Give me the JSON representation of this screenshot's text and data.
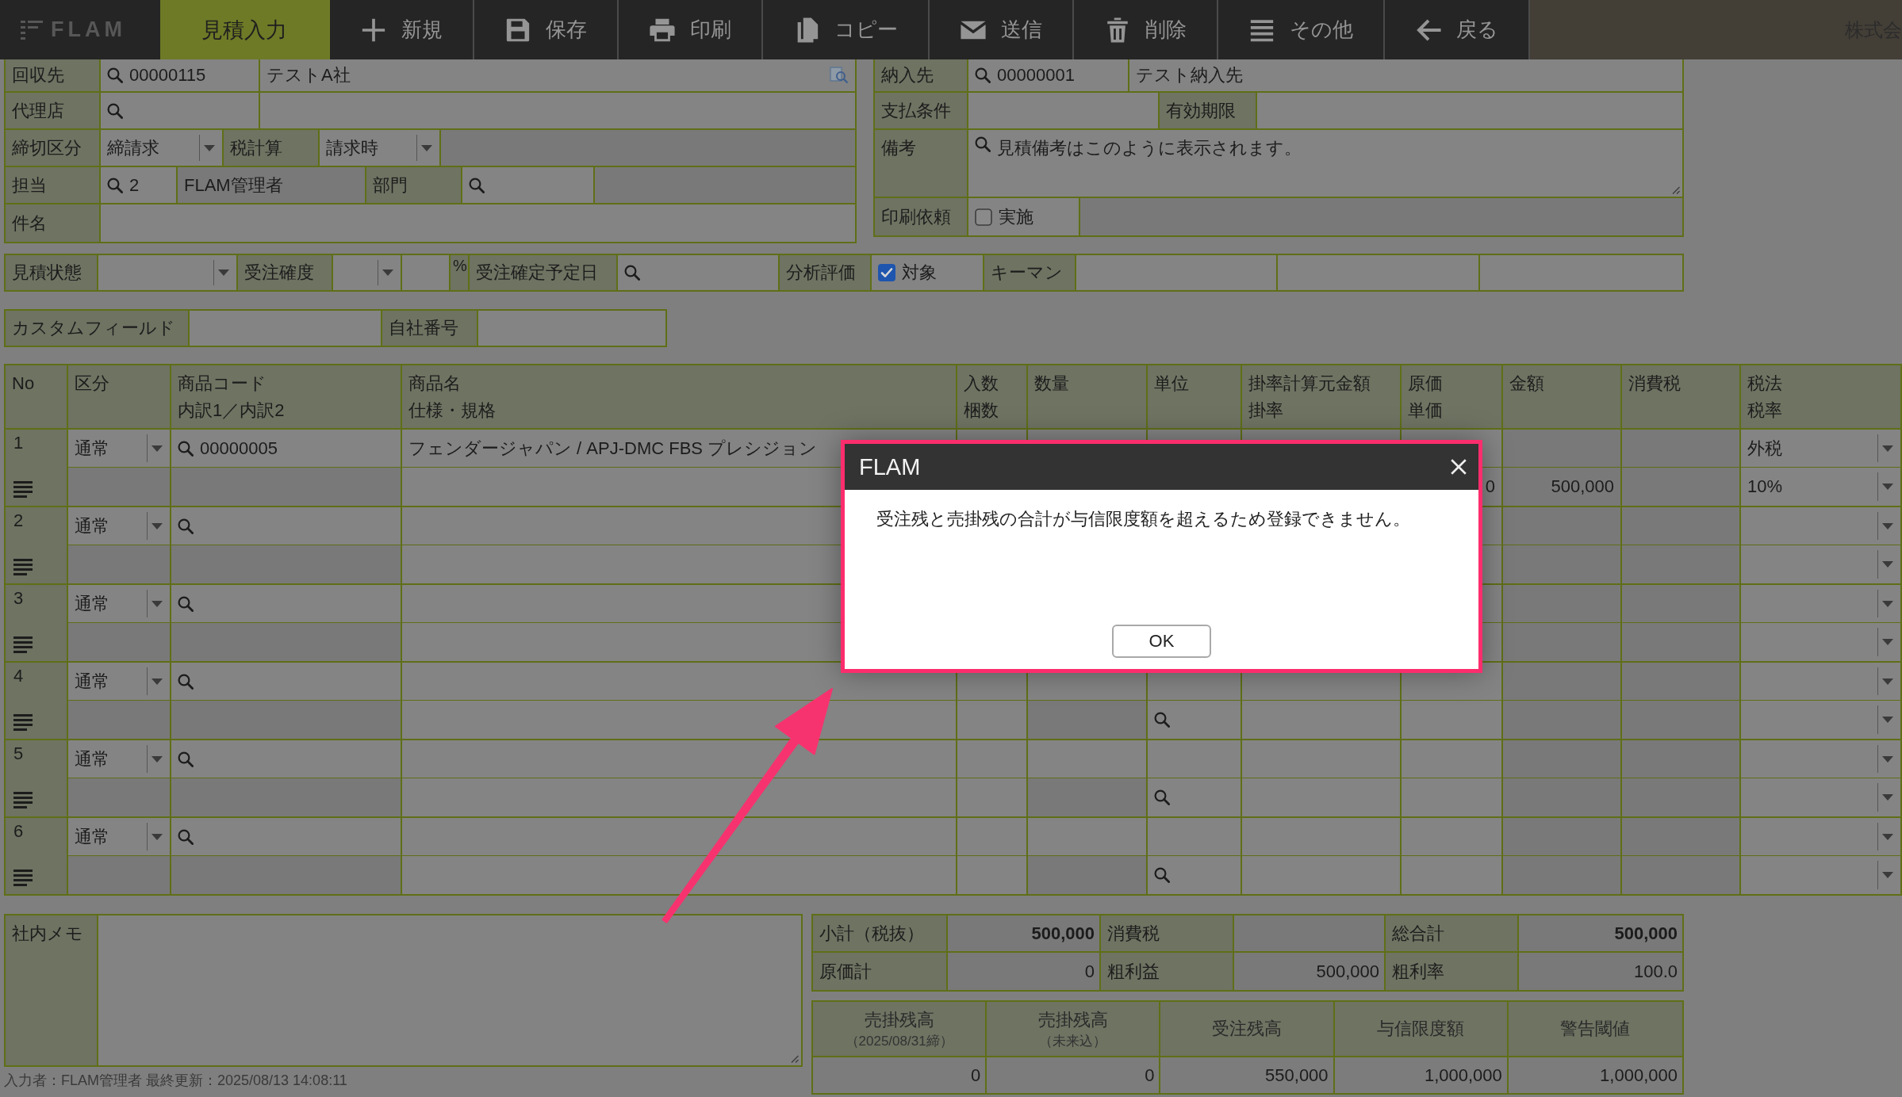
{
  "toolbar": {
    "logo": "FLAM",
    "mode_tab": {
      "label": "見積入力",
      "selected": true
    },
    "buttons": [
      {
        "kind": "new",
        "label": "新規"
      },
      {
        "kind": "save",
        "label": "保存"
      },
      {
        "kind": "print",
        "label": "印刷"
      },
      {
        "kind": "copy",
        "label": "コピー"
      },
      {
        "kind": "send",
        "label": "送信"
      },
      {
        "kind": "delete",
        "label": "削除"
      },
      {
        "kind": "more",
        "label": "その他"
      },
      {
        "kind": "back",
        "label": "戻る"
      }
    ],
    "company": "株式会"
  },
  "customer_block": {
    "billing_to": {
      "label": "回収先",
      "code": "00000115",
      "name": "テストA社"
    },
    "agent": {
      "label": "代理店"
    },
    "closing": {
      "label": "締切区分",
      "value": "締請求",
      "tax_calc_label": "税計算",
      "tax_calc": "請求時"
    },
    "staff": {
      "label": "担当",
      "code": "2",
      "name": "FLAM管理者",
      "department_label": "部門"
    },
    "subject": {
      "label": "件名"
    }
  },
  "delivery_block": {
    "delivery_to": {
      "label": "納入先",
      "code": "00000001",
      "name": "テスト納入先"
    },
    "payment": {
      "label": "支払条件",
      "expiry_label": "有効期限"
    },
    "remarks": {
      "label": "備考",
      "value": "見積備考はこのように表示されます。"
    },
    "print_request": {
      "label": "印刷依頼",
      "option": "実施",
      "checked": false
    }
  },
  "status_row": {
    "estimate_status_label": "見積状態",
    "probability_label": "受注確度",
    "percent": "%",
    "expected_date_label": "受注確定予定日",
    "analysis_label": "分析評価",
    "analysis": {
      "option": "対象",
      "checked": true
    },
    "keyman_label": "キーマン"
  },
  "custom_row": {
    "custom_field_label": "カスタムフィールド",
    "own_number_label": "自社番号"
  },
  "table": {
    "columns": [
      [
        "No"
      ],
      [
        "区分"
      ],
      [
        "商品コード",
        "内訳1／内訳2"
      ],
      [
        "商品名",
        "仕様・規格"
      ],
      [
        "入数",
        "梱数"
      ],
      [
        "数量"
      ],
      [
        "単位"
      ],
      [
        "掛率計算元金額",
        "掛率"
      ],
      [
        "原価",
        "単価"
      ],
      [
        "金額"
      ],
      [
        "消費税"
      ],
      [
        "税法",
        "税率"
      ]
    ],
    "rows": [
      {
        "no": "1",
        "category": "通常",
        "code": "00000005",
        "product": "フェンダージャパン / APJ-DMC FBS プレシジョン",
        "unit_price": "0",
        "amount": "500,000",
        "tax_law": "外税",
        "tax_rate": "10%"
      },
      {
        "no": "2",
        "category": "通常"
      },
      {
        "no": "3",
        "category": "通常"
      },
      {
        "no": "4",
        "category": "通常"
      },
      {
        "no": "5",
        "category": "通常"
      },
      {
        "no": "6",
        "category": "通常"
      }
    ]
  },
  "memo": {
    "label": "社内メモ"
  },
  "footer": "入力者：FLAM管理者 最終更新：2025/08/13 14:08:11",
  "totals": {
    "rows": [
      [
        {
          "label": "小計（税抜）",
          "value": "500,000",
          "bold": true
        },
        {
          "label": "消費税"
        },
        {
          "label": "総合計",
          "value": "500,000",
          "bold": true
        }
      ],
      [
        {
          "label": "原価計",
          "value": "0",
          "bold": false
        },
        {
          "label": "粗利益",
          "value": "500,000",
          "bold": false
        },
        {
          "label": "粗利率",
          "value": "100.0",
          "bold": false
        }
      ]
    ]
  },
  "credit": {
    "columns": [
      {
        "title": "売掛残高",
        "note": "（2025/08/31締）",
        "value": "0"
      },
      {
        "title": "売掛残高",
        "note": "（未来込）",
        "value": "0"
      },
      {
        "title": "受注残高",
        "value": "550,000"
      },
      {
        "title": "与信限度額",
        "value": "1,000,000"
      },
      {
        "title": "警告閾値",
        "value": "1,000,000"
      }
    ]
  },
  "dialog": {
    "title": "FLAM",
    "message": "受注残と売掛残の合計が与信限度額を超えるため登録できません。",
    "ok": "OK"
  }
}
